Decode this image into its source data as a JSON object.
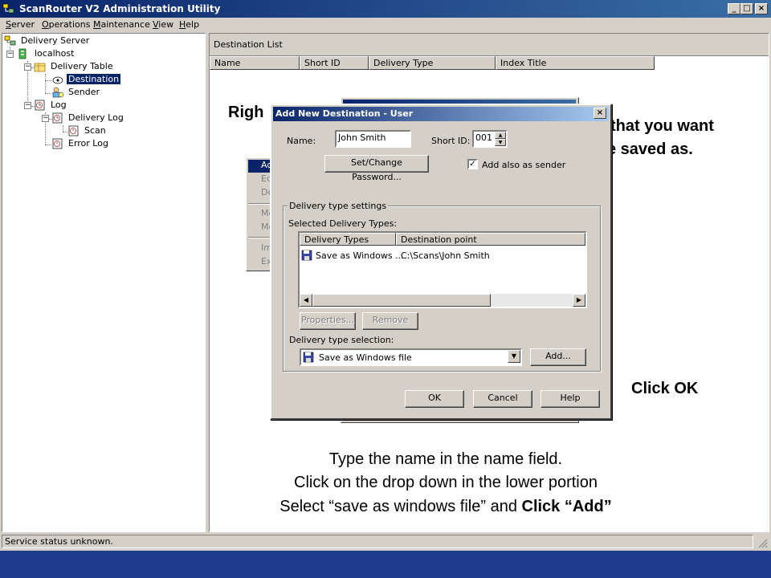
{
  "window": {
    "title": "ScanRouter V2 Administration Utility",
    "caption_minimize": "_",
    "caption_maximize": "□",
    "caption_close": "×"
  },
  "menu": [
    "Server",
    "Operations",
    "Maintenance",
    "View",
    "Help"
  ],
  "tree": {
    "root": "Delivery Server",
    "localhost": "localhost",
    "delivery_table": "Delivery Table",
    "destination": "Destination",
    "sender": "Sender",
    "log": "Log",
    "delivery_log": "Delivery Log",
    "scan": "Scan",
    "error_log": "Error Log"
  },
  "right_panel": {
    "header": "Destination List",
    "columns": [
      "Name",
      "Short ID",
      "Delivery Type",
      "Index Title"
    ]
  },
  "context_menu": {
    "items": [
      "Ad",
      "Ed",
      "De",
      "Mo",
      "Mo",
      "Im",
      "Ex"
    ]
  },
  "dialog": {
    "title": "Add New Destination - User",
    "close": "×",
    "name_label": "Name:",
    "name_value": "John Smith",
    "shortid_label": "Short ID:",
    "shortid_value": "001",
    "password_button": "Set/Change Password...",
    "add_sender_label": "Add also as sender",
    "add_sender_checked": "✓",
    "group_title": "Delivery type settings",
    "selected_types_label": "Selected Delivery Types:",
    "list_columns": [
      "Delivery Types",
      "Destination point"
    ],
    "list_rows": [
      {
        "type": "Save as Windows ...",
        "point": "C:\\Scans\\John Smith"
      }
    ],
    "properties_button": "Properties...",
    "remove_button": "Remove",
    "selection_label": "Delivery type selection:",
    "selection_value": "Save as Windows file",
    "add_button": "Add...",
    "ok_button": "OK",
    "cancel_button": "Cancel",
    "help_button": "Help"
  },
  "overlay": {
    "top_left": "Righ",
    "top_right_line1": "that you want",
    "top_right_line2": "e saved as.",
    "click_ok": "Click OK",
    "instruction_line1": "Type the name in the name field.",
    "instruction_line2": "Click on the drop down in the lower portion",
    "instruction_line3_pre": "Select “save as windows file” and ",
    "instruction_line3_bold": "Click “Add”"
  },
  "status": {
    "text": "Service status unknown."
  }
}
